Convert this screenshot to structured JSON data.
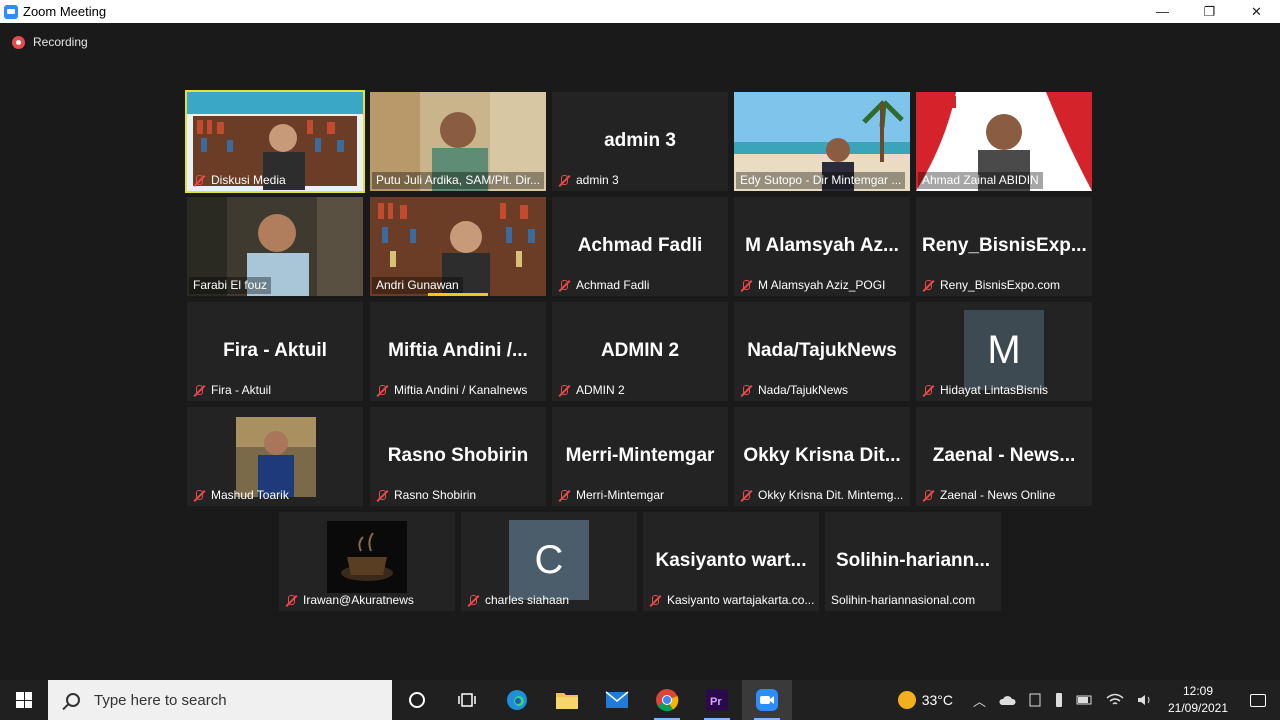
{
  "window": {
    "title": "Zoom Meeting",
    "minimize": "—",
    "maximize": "❐",
    "close": "✕"
  },
  "recording": {
    "label": "Recording"
  },
  "participants": [
    {
      "label": "Diskusi Media",
      "big": "",
      "muted": true,
      "pinned": true,
      "type": "video"
    },
    {
      "label": "Putu Juli Ardika, SAM/Plt. Dir...",
      "big": "",
      "muted": false,
      "type": "video"
    },
    {
      "label": "admin 3",
      "big": "admin 3",
      "muted": true,
      "type": "name"
    },
    {
      "label": "Edy Sutopo - Dir Mintemgar ...",
      "big": "",
      "muted": false,
      "type": "video"
    },
    {
      "label": "Ahmad Zainal ABIDIN",
      "big": "",
      "muted": false,
      "type": "video"
    },
    {
      "label": "Farabi El fouz",
      "big": "",
      "muted": false,
      "type": "video"
    },
    {
      "label": "Andri Gunawan",
      "big": "",
      "muted": false,
      "type": "video"
    },
    {
      "label": "Achmad Fadli",
      "big": "Achmad Fadli",
      "muted": true,
      "type": "name"
    },
    {
      "label": "M Alamsyah Aziz_POGI",
      "big": "M Alamsyah Az...",
      "muted": true,
      "type": "name"
    },
    {
      "label": "Reny_BisnisExpo.com",
      "big": "Reny_BisnisExp...",
      "muted": true,
      "type": "name"
    },
    {
      "label": "Fira - Aktuil",
      "big": "Fira - Aktuil",
      "muted": true,
      "type": "name"
    },
    {
      "label": "Miftia Andini / Kanalnews",
      "big": "Miftia Andini /...",
      "muted": true,
      "type": "name"
    },
    {
      "label": "ADMIN 2",
      "big": "ADMIN 2",
      "muted": true,
      "type": "name"
    },
    {
      "label": "Nada/TajukNews",
      "big": "Nada/TajukNews",
      "muted": true,
      "type": "name"
    },
    {
      "label": "Hidayat LintasBisnis",
      "big": "M",
      "muted": true,
      "type": "avatar"
    },
    {
      "label": "Mashud Toarik",
      "big": "",
      "muted": true,
      "type": "photo"
    },
    {
      "label": "Rasno Shobirin",
      "big": "Rasno Shobirin",
      "muted": true,
      "type": "name"
    },
    {
      "label": "Merri-Mintemgar",
      "big": "Merri-Mintemgar",
      "muted": true,
      "type": "name"
    },
    {
      "label": "Okky Krisna Dit. Mintemg...",
      "big": "Okky Krisna Dit...",
      "muted": true,
      "type": "name"
    },
    {
      "label": "Zaenal - News Online",
      "big": "Zaenal - News...",
      "muted": true,
      "type": "name"
    },
    {
      "label": "Irawan@Akuratnews",
      "big": "",
      "muted": true,
      "type": "photo"
    },
    {
      "label": "charles siahaan",
      "big": "C",
      "muted": true,
      "type": "avatar"
    },
    {
      "label": "Kasiyanto wartajakarta.co...",
      "big": "Kasiyanto wart...",
      "muted": true,
      "type": "name"
    },
    {
      "label": "Solihin-hariannasional.com",
      "big": "Solihin-hariann...",
      "muted": false,
      "type": "name"
    }
  ],
  "taskbar": {
    "search_placeholder": "Type here to search",
    "temperature": "33°C",
    "time": "12:09",
    "date": "21/09/2021"
  },
  "colors": {
    "accent_pin": "#e2e23a",
    "muted_red": "#e84a4a",
    "zoom_blue": "#2d8cff"
  }
}
